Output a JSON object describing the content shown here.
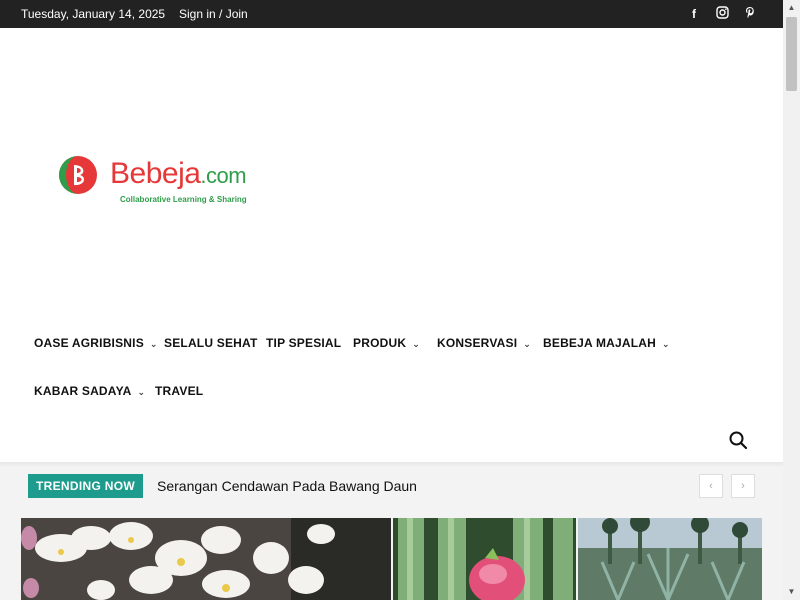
{
  "topbar": {
    "date": "Tuesday, January 14, 2025",
    "signin": "Sign in / Join",
    "social": {
      "facebook": "f",
      "instagram": "◎",
      "pinterest": "𝓅"
    }
  },
  "logo": {
    "name_main": "Bebeja",
    "name_suffix": ".com",
    "tagline": "Collaborative Learning & Sharing"
  },
  "nav": {
    "items": [
      {
        "label": "OASE AGRIBISNIS",
        "dropdown": true
      },
      {
        "label": "SELALU SEHAT",
        "dropdown": false
      },
      {
        "label": "TIP SPESIAL",
        "dropdown": false
      },
      {
        "label": "PRODUK",
        "dropdown": true
      },
      {
        "label": "KONSERVASI",
        "dropdown": true
      },
      {
        "label": "BEBEJA MAJALAH",
        "dropdown": true
      },
      {
        "label": "KABAR SADAYA",
        "dropdown": true
      },
      {
        "label": "TRAVEL",
        "dropdown": false
      }
    ],
    "chevron": "⌄"
  },
  "trending": {
    "label": "TRENDING NOW",
    "title": "Serangan Cendawan Pada Bawang Daun",
    "prev": "‹",
    "next": "›"
  },
  "scrollbar": {
    "up": "▲",
    "down": "▼"
  },
  "colors": {
    "accent": "#1d9b8c",
    "topbar": "#222222",
    "brand_red": "#e63838",
    "brand_green": "#2e9e4a"
  }
}
